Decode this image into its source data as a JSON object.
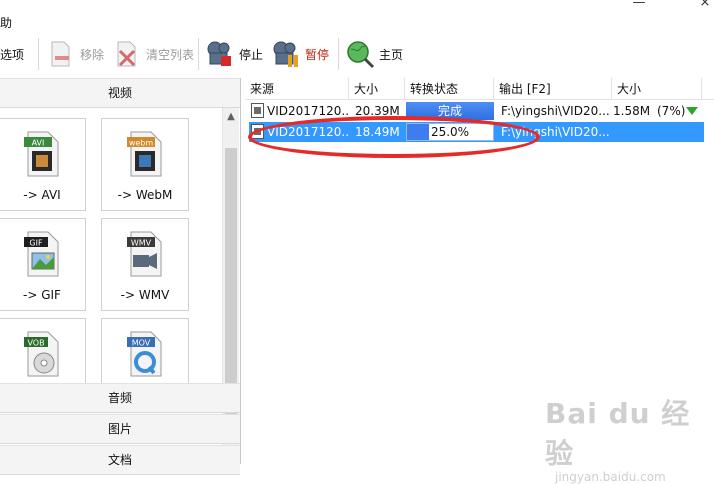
{
  "menu": {
    "help": "助"
  },
  "window": {
    "min_glyph": "—",
    "close_glyph": "×"
  },
  "toolbar": {
    "options": "选项",
    "remove": "移除",
    "clear_list": "清空列表",
    "stop": "停止",
    "pause": "暂停",
    "home": "主页"
  },
  "left_panel": {
    "video_header": "视频",
    "audio_header": "音频",
    "image_header": "图片",
    "doc_header": "文档",
    "formats": [
      {
        "badge": "AVI",
        "label": "-> AVI",
        "badge_color": "#3b8a3b"
      },
      {
        "badge": "webm",
        "label": "-> WebM",
        "badge_color": "#d08a2a"
      },
      {
        "badge": "GIF",
        "label": "-> GIF",
        "badge_color": "#1f1f1f"
      },
      {
        "badge": "WMV",
        "label": "-> WMV",
        "badge_color": "#3b3b3b"
      },
      {
        "badge": "VOB",
        "label": "",
        "badge_color": "#2a6a2a"
      },
      {
        "badge": "MOV",
        "label": "",
        "badge_color": "#3a6fb8"
      }
    ]
  },
  "table": {
    "headers": [
      "来源",
      "大小",
      "转换状态",
      "输出 [F2]",
      "大小"
    ],
    "rows": [
      {
        "source": "VID2017120...",
        "size": "20.39M",
        "status": "完成",
        "progress": 1.0,
        "output": "F:\\yingshi\\VID20...",
        "out_size": "1.58M",
        "ratio": "(7%)"
      },
      {
        "source": "VID2017120...",
        "size": "18.49M",
        "status": "25.0%",
        "progress": 0.25,
        "output": "F:\\yingshi\\VID20...",
        "out_size": "",
        "ratio": ""
      }
    ]
  },
  "colors": {
    "selected_row": "#3399ff",
    "annotation": "#e52a2a",
    "pause_text": "#c3220f"
  },
  "watermark": {
    "logo": "Bai du 经验",
    "url": "jingyan.baidu.com"
  }
}
